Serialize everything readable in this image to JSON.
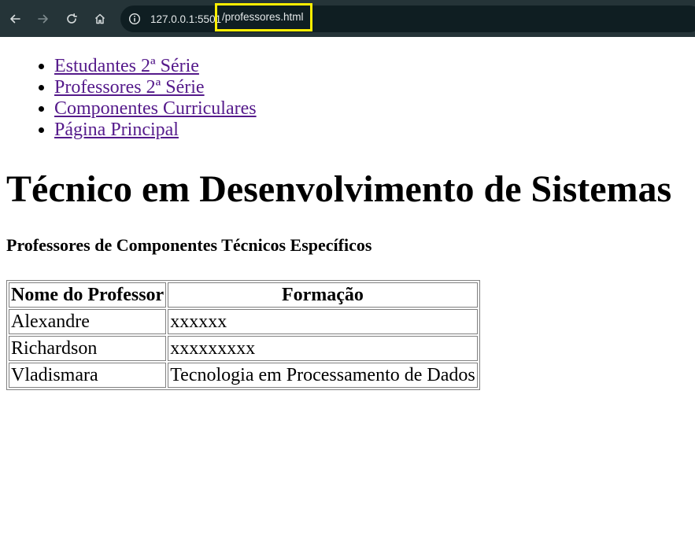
{
  "browser": {
    "url_host": "127.0.0.1:5501",
    "url_path": "/professores.html",
    "highlight_color": "#ffee00"
  },
  "nav": {
    "items": [
      {
        "label": "Estudantes 2ª Série"
      },
      {
        "label": "Professores 2ª Série"
      },
      {
        "label": "Componentes Curriculares"
      },
      {
        "label": "Página Principal"
      }
    ]
  },
  "page": {
    "title": "Técnico em Desenvolvimento de Sistemas",
    "subtitle": "Professores de Componentes Técnicos Específicos"
  },
  "table": {
    "headers": [
      "Nome do Professor",
      "Formação"
    ],
    "rows": [
      [
        "Alexandre",
        "xxxxxx"
      ],
      [
        "Richardson",
        "xxxxxxxxx"
      ],
      [
        "Vladismara",
        "Tecnologia em Processamento de Dados"
      ]
    ]
  },
  "colors": {
    "link_visited": "#551a8b",
    "browser_bar": "#253438"
  }
}
